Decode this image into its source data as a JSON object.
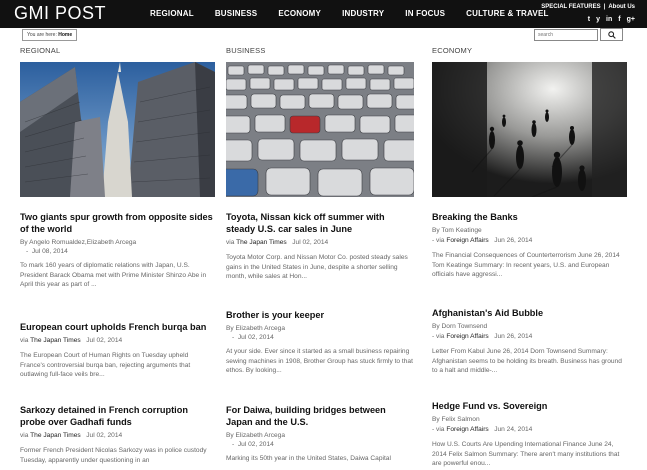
{
  "header": {
    "logo": "GMI POST",
    "nav": [
      "REGIONAL",
      "BUSINESS",
      "ECONOMY",
      "INDUSTRY",
      "IN FOCUS",
      "CULTURE & TRAVEL"
    ],
    "special_features": "SPECIAL FEATURES",
    "separator": "|",
    "about": "About Us",
    "social": [
      "t",
      "y",
      "in",
      "f",
      "g+"
    ]
  },
  "breadcrumb": {
    "prefix": "You are here:",
    "current": "Home"
  },
  "search": {
    "placeholder": "search"
  },
  "columns": [
    {
      "label": "REGIONAL",
      "articles": [
        {
          "title": "Two giants spur growth from opposite sides of the world",
          "meta": "By Angelo Romualdez,Elizabeth Arcega",
          "date": "Jul 08, 2014",
          "excerpt": "To mark 160 years of diplomatic relations with Japan, U.S. President Barack Obama met with Prime Minister Shinzo Abe in April this year as part of ..."
        },
        {
          "title": "European court upholds French burqa ban",
          "via": "via",
          "source": "The Japan Times",
          "date": "Jul 02, 2014",
          "excerpt": "The European Court of Human Rights on Tuesday upheld France's controversial burqa ban, rejecting arguments that outlawing full-face veils bre..."
        },
        {
          "title": "Sarkozy detained in French corruption probe over Gadhafi funds",
          "via": "via",
          "source": "The Japan Times",
          "date": "Jul 02, 2014",
          "excerpt": "Former French President Nicolas Sarkozy was in police custody Tuesday, apparently under questioning in an"
        }
      ]
    },
    {
      "label": "BUSINESS",
      "articles": [
        {
          "title": "Toyota, Nissan kick off summer with steady U.S. car sales in June",
          "via": "via",
          "source": "The Japan Times",
          "date": "Jul 02, 2014",
          "excerpt": "Toyota Motor Corp. and Nissan Motor Co. posted steady sales gains in the United States in June, despite a shorter selling month, while sales at Hon..."
        },
        {
          "title": "Brother is your keeper",
          "meta": "By Elizabeth Arcega",
          "date": "Jul 02, 2014",
          "excerpt": "At your side. Ever since it started as a small business repairing sewing machines in 1908, Brother Group has stuck firmly to that ethos. By looking..."
        },
        {
          "title": "For Daiwa, building bridges between Japan and the U.S.",
          "meta": "By Elizabeth Arcega",
          "date": "Jul 02, 2014",
          "excerpt": "Marking its 50th year in the United States, Daiwa Capital"
        }
      ]
    },
    {
      "label": "ECONOMY",
      "articles": [
        {
          "title": "Breaking the Banks",
          "meta": "By Tom Keatinge",
          "via": "- via",
          "source": "Foreign Affairs",
          "date": "Jun 26, 2014",
          "excerpt": "The Financial Consequences of Counterterrorism June 26, 2014 Tom Keatinge Summary:  In recent years, U.S. and European officials have aggressi..."
        },
        {
          "title": "Afghanistan's Aid Bubble",
          "meta": "By Dorn Townsend",
          "via": "- via",
          "source": "Foreign Affairs",
          "date": "Jun 26, 2014",
          "excerpt": "Letter From Kabul June 26, 2014 Dorn Townsend Summary:  Afghanistan seems to be holding its breath. Business has ground to a halt and middle-..."
        },
        {
          "title": "Hedge Fund vs. Sovereign",
          "meta": "By Felix Salmon",
          "via": "- via",
          "source": "Foreign Affairs",
          "date": "Jun 24, 2014",
          "excerpt": "How U.S. Courts Are Upending International Finance June 24, 2014 Felix Salmon Summary:  There aren't many institutions that are powerful enou..."
        }
      ]
    }
  ]
}
